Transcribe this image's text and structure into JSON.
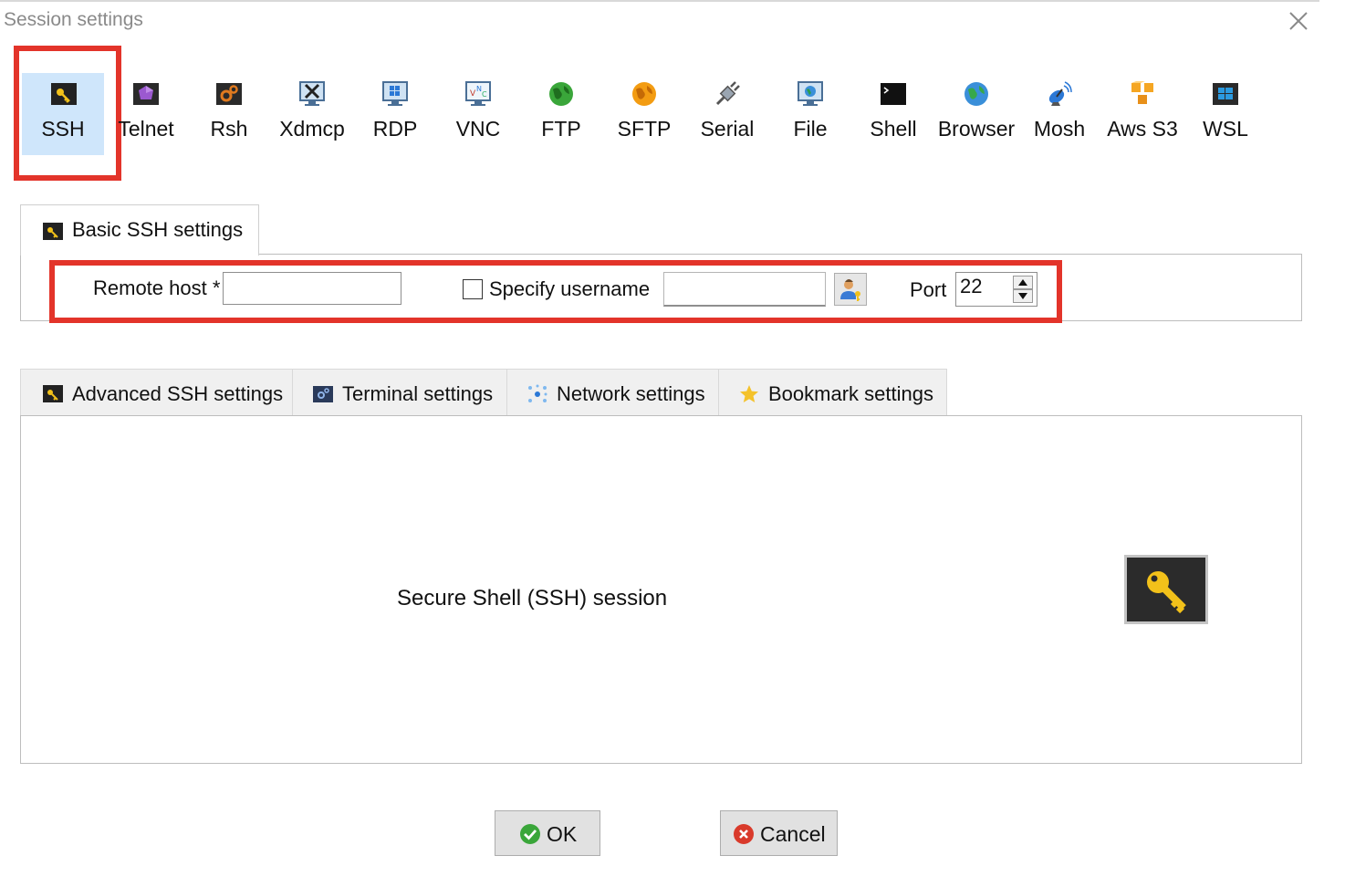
{
  "window": {
    "title": "Session settings"
  },
  "session_types": [
    {
      "label": "SSH",
      "icon": "ssh-key-icon",
      "selected": true
    },
    {
      "label": "Telnet",
      "icon": "telnet-icon"
    },
    {
      "label": "Rsh",
      "icon": "rsh-icon"
    },
    {
      "label": "Xdmcp",
      "icon": "xdmcp-icon"
    },
    {
      "label": "RDP",
      "icon": "rdp-icon"
    },
    {
      "label": "VNC",
      "icon": "vnc-icon"
    },
    {
      "label": "FTP",
      "icon": "ftp-globe-icon"
    },
    {
      "label": "SFTP",
      "icon": "sftp-globe-icon"
    },
    {
      "label": "Serial",
      "icon": "serial-plug-icon"
    },
    {
      "label": "File",
      "icon": "file-monitor-icon"
    },
    {
      "label": "Shell",
      "icon": "shell-terminal-icon"
    },
    {
      "label": "Browser",
      "icon": "browser-globe-icon"
    },
    {
      "label": "Mosh",
      "icon": "mosh-satellite-icon"
    },
    {
      "label": "Aws S3",
      "icon": "aws-s3-cubes-icon"
    },
    {
      "label": "WSL",
      "icon": "wsl-windows-icon"
    }
  ],
  "basic_tab": {
    "label": "Basic SSH settings",
    "icon": "ssh-key-icon"
  },
  "basic": {
    "remote_host_label": "Remote host *",
    "remote_host_value": "",
    "specify_username_label": "Specify username",
    "specify_username_checked": false,
    "username_value": "",
    "port_label": "Port",
    "port_value": "22"
  },
  "advanced_tabs": [
    {
      "label": "Advanced SSH settings",
      "icon": "ssh-key-icon"
    },
    {
      "label": "Terminal settings",
      "icon": "terminal-settings-icon"
    },
    {
      "label": "Network settings",
      "icon": "network-settings-icon"
    },
    {
      "label": "Bookmark settings",
      "icon": "star-icon"
    }
  ],
  "panel": {
    "description": "Secure Shell (SSH) session"
  },
  "buttons": {
    "ok": "OK",
    "cancel": "Cancel"
  },
  "colors": {
    "highlight_red": "#e3342a",
    "selected_bg": "#cfe6fb",
    "ok_green": "#3aa63a",
    "cancel_red": "#d93a2b",
    "key_yellow": "#f2c11a"
  }
}
